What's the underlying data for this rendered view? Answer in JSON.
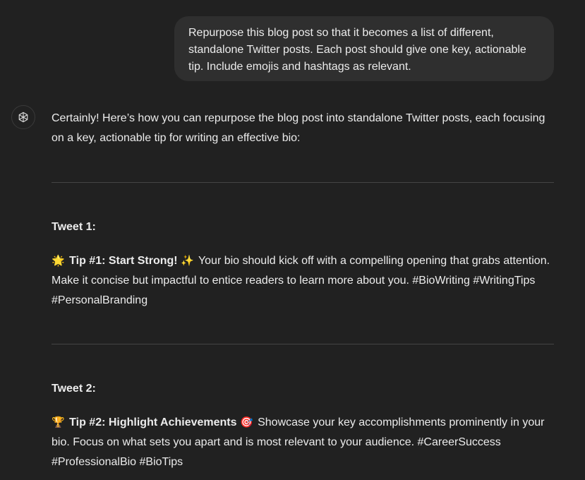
{
  "user_message": "Repurpose this blog post so that it becomes a list of different, standalone Twitter posts. Each post should give one key, actionable tip. Include emojis and hashtags as relevant.",
  "assistant": {
    "intro": "Certainly! Here’s how you can repurpose the blog post into standalone Twitter posts, each focusing on a key, actionable tip for writing an effective bio:",
    "tweets": [
      {
        "heading": "Tweet 1:",
        "emoji_lead": "🌟",
        "title": "Tip #1: Start Strong!",
        "emoji_trail": "✨",
        "body": " Your bio should kick off with a compelling opening that grabs attention. Make it concise but impactful to entice readers to learn more about you. #BioWriting #WritingTips #PersonalBranding"
      },
      {
        "heading": "Tweet 2:",
        "emoji_lead": "🏆",
        "title": "Tip #2: Highlight Achievements",
        "emoji_trail": "🎯",
        "body": " Showcase your key accomplishments prominently in your bio. Focus on what sets you apart and is most relevant to your audience. #CareerSuccess #ProfessionalBio #BioTips"
      }
    ]
  },
  "icons": {
    "assistant_avatar": "openai-logo-icon"
  }
}
